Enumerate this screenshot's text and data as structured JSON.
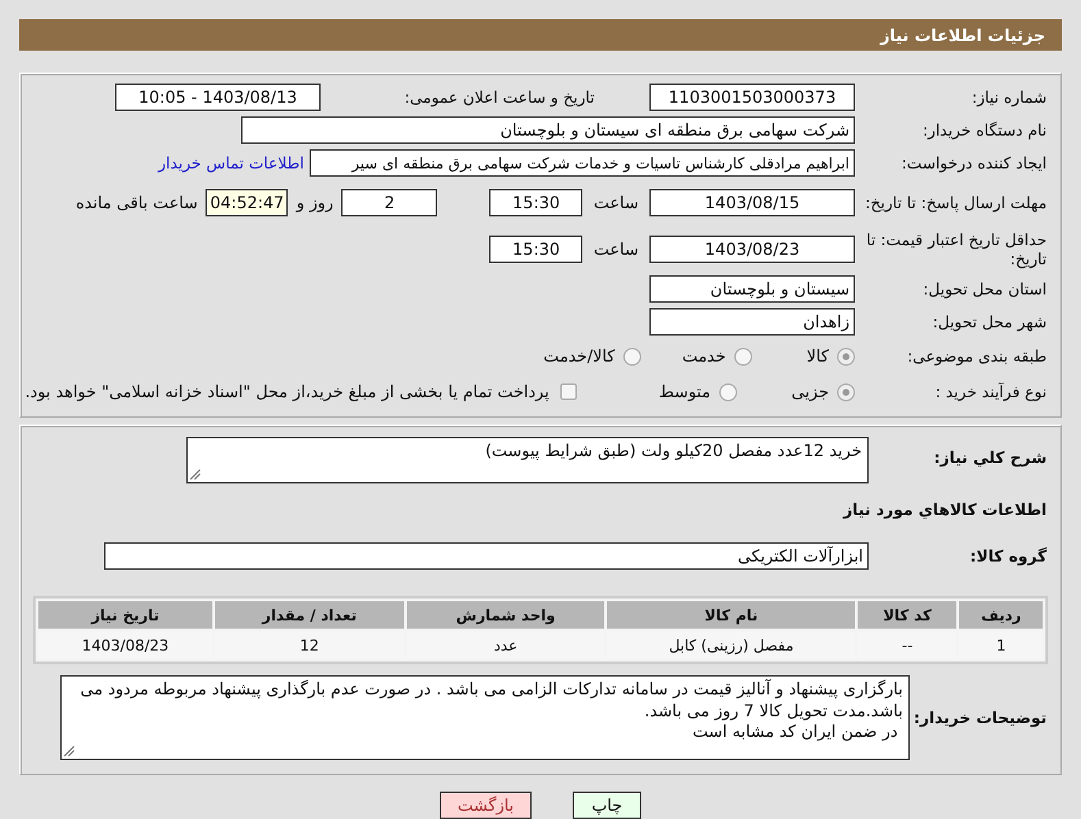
{
  "header": {
    "title": "جزئیات اطلاعات نیاز"
  },
  "need_number": {
    "label": "شماره نیاز:",
    "value": "1103001503000373"
  },
  "announce": {
    "label": "تاریخ و ساعت اعلان عمومی:",
    "value": "1403/08/13 - 10:05"
  },
  "buyer_org": {
    "label": "نام دستگاه خریدار:",
    "value": "شرکت سهامی برق منطقه ای سیستان و بلوچستان"
  },
  "requester": {
    "label": "ایجاد کننده درخواست:",
    "value": "ابراهیم مرادقلی کارشناس تاسیات و خدمات شرکت سهامی برق منطقه ای سیر",
    "link": "اطلاعات تماس خریدار"
  },
  "response_deadline": {
    "label": "مهلت ارسال پاسخ: تا تاریخ:",
    "date": "1403/08/15",
    "time_label": "ساعت",
    "time": "15:30",
    "days": "2",
    "days_label": "روز و",
    "remaining": "04:52:47",
    "remaining_label": "ساعت باقی مانده"
  },
  "price_validity": {
    "label": "حداقل تاریخ اعتبار قیمت: تا تاریخ:",
    "date": "1403/08/23",
    "time_label": "ساعت",
    "time": "15:30"
  },
  "province": {
    "label": "استان محل تحویل:",
    "value": "سیستان و بلوچستان"
  },
  "city": {
    "label": "شهر محل تحویل:",
    "value": "زاهدان"
  },
  "category": {
    "label": "طبقه بندی موضوعی:",
    "options": [
      {
        "label": "کالا",
        "selected": true
      },
      {
        "label": "خدمت",
        "selected": false
      },
      {
        "label": "کالا/خدمت",
        "selected": false
      }
    ]
  },
  "process": {
    "label": "نوع فرآیند خرید :",
    "options": [
      {
        "label": "جزیی",
        "selected": true
      },
      {
        "label": "متوسط",
        "selected": false
      }
    ],
    "checkbox": {
      "label": "پرداخت تمام یا بخشی از مبلغ خرید،از محل \"اسناد خزانه اسلامی\" خواهد بود.",
      "checked": false
    }
  },
  "description": {
    "label": "شرح کلي نياز:",
    "value": "خرید 12عدد مفصل 20کیلو ولت (طبق شرایط پیوست)"
  },
  "goods_title": "اطلاعات کالاهاي مورد نياز",
  "goods_group": {
    "label": "گروه کالا:",
    "value": "ابزارآلات الکتریکی"
  },
  "table": {
    "columns": [
      "ردیف",
      "کد کالا",
      "نام کالا",
      "واحد شمارش",
      "تعداد / مقدار",
      "تاریخ نیاز"
    ],
    "rows": [
      [
        "1",
        "--",
        "مفصل (رزینی) کابل",
        "عدد",
        "12",
        "1403/08/23"
      ]
    ]
  },
  "buyer_notes": {
    "label": "توضیحات خریدار:",
    "value": "بارگزاری پیشنهاد و آنالیز قیمت در سامانه تدارکات الزامی می باشد . در صورت عدم بارگذاری پیشنهاد مربوطه مردود می باشد.مدت تحویل کالا 7 روز می باشد.\n در ضمن ایران کد مشابه است"
  },
  "buttons": [
    {
      "label": "چاپ",
      "kind": "print"
    },
    {
      "label": "بازگشت",
      "kind": "back"
    }
  ]
}
